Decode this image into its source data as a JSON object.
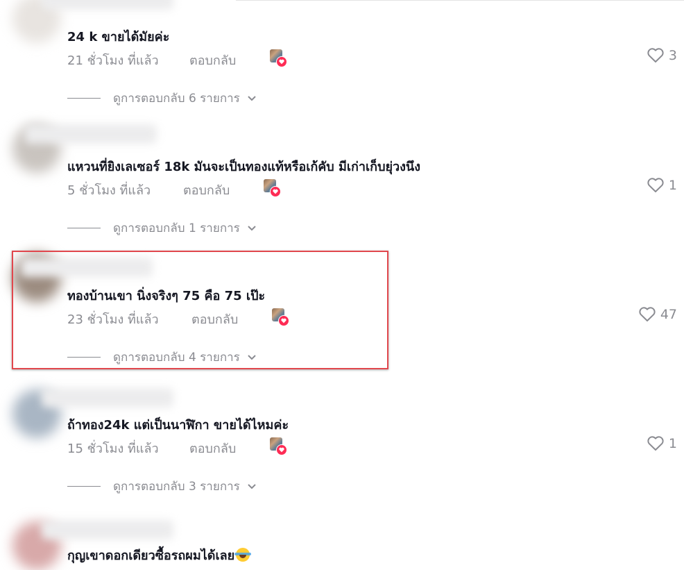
{
  "comments": [
    {
      "text": "24 k ขายได้มัยค่ะ",
      "time": "21 ชั่วโมง ที่แล้ว",
      "reply": "ตอบกลับ",
      "likes": "3",
      "view_replies": "ดูการตอบกลับ 6 รายการ",
      "avatar_color": "#e8e4e0"
    },
    {
      "text": "แหวนที่ยิงเลเซอร์ 18k มันจะเป็นทองแท้หรือเก้คับ มีเก่าเก็บยุ่วงนึง",
      "time": "5 ชั่วโมง ที่แล้ว",
      "reply": "ตอบกลับ",
      "likes": "1",
      "view_replies": "ดูการตอบกลับ 1 รายการ",
      "avatar_color": "#c9c4bf"
    },
    {
      "text": "ทองบ้านเขา นิ่งจริงๆ 75 คือ 75 เป๊ะ",
      "time": "23 ชั่วโมง ที่แล้ว",
      "reply": "ตอบกลับ",
      "likes": "47",
      "view_replies": "ดูการตอบกลับ 4 รายการ",
      "avatar_color": "#9c8c80"
    },
    {
      "text": "ถ้าทอง24k แต่เป็นนาฬิกา ขายได้ไหมค่ะ",
      "time": "15 ชั่วโมง ที่แล้ว",
      "reply": "ตอบกลับ",
      "likes": "1",
      "view_replies": "ดูการตอบกลับ 3 รายการ",
      "avatar_color": "#a9b6c4"
    },
    {
      "text": "กุญเขาดอกเดียวซื้อรถผมได้เลย",
      "avatar_color": "#d8a9a9"
    }
  ],
  "icons": {
    "like": "heart-outline-icon",
    "expand": "chevron-down-icon",
    "creator_badge": "creator-liked-icon",
    "emoji": "laughing-tears-emoji"
  },
  "colors": {
    "muted": "#8a8b91",
    "text": "#161823",
    "highlight": "#e1474d",
    "like_badge": "#fe2c55"
  }
}
